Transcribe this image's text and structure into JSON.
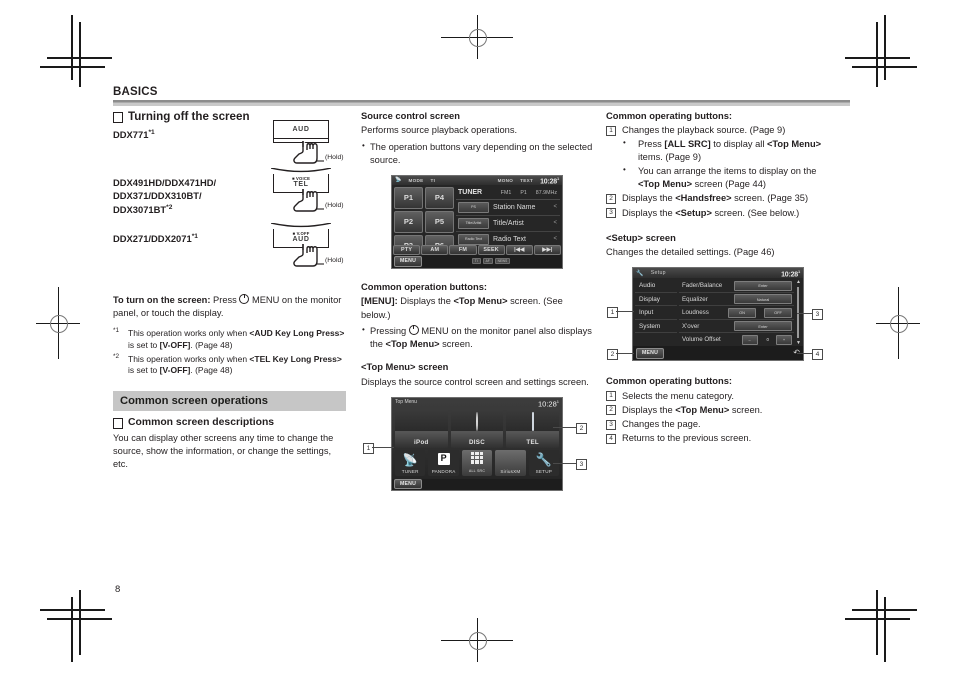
{
  "document": {
    "chapter": "BASICS",
    "page_number": "8"
  },
  "left_column": {
    "heading": "Turning off the screen",
    "models": [
      {
        "name": "DDX771",
        "footnote": "*1"
      },
      {
        "name": "DDX491HD/DDX471HD/\nDDX371/DDX310BT/\nDDX3071BT",
        "footnote": "*2"
      },
      {
        "name": "DDX271/DDX2071",
        "footnote": "*1"
      }
    ],
    "model_1_line": "DDX771",
    "model_2_line_1": "DDX491HD/DDX471HD/",
    "model_2_line_2": "DDX371/DDX310BT/",
    "model_2_line_3": "DDX3071BT",
    "model_3_line": "DDX271/DDX2071",
    "buttons": [
      {
        "key_sub": "",
        "key_label": "AUD",
        "hold": "(Hold)"
      },
      {
        "key_sub": "VOICE",
        "key_label": "TEL",
        "hold": "(Hold)"
      },
      {
        "key_sub": "V.OFF",
        "key_label": "AUD",
        "hold": "(Hold)"
      }
    ],
    "turn_on_label": "To turn on the screen:",
    "turn_on_text_a": " Press ",
    "turn_on_text_b": " MENU on the monitor panel, or touch the display.",
    "footnotes": [
      {
        "mark": "*1",
        "text_a": "This operation works only when ",
        "bold_a": "<AUD Key Long Press>",
        "text_b": " is set to ",
        "bold_b": "[V-OFF]",
        "text_c": ". (Page 48)"
      },
      {
        "mark": "*2",
        "text_a": "This operation works only when ",
        "bold_a": "<TEL Key Long Press>",
        "text_b": " is set to ",
        "bold_b": "[V-OFF]",
        "text_c": ". (Page 48)"
      }
    ],
    "section_bar": "Common screen operations",
    "subheading": "Common screen descriptions",
    "body": "You can display other screens any time to change the source, show the information, or change the settings, etc."
  },
  "middle_column": {
    "heading1": "Source control screen",
    "body1": "Performs source playback operations.",
    "bullet1": "The operation buttons vary depending on the selected source.",
    "heading2": "Common operation buttons:",
    "menu_label": "[MENU]:",
    "menu_text_a": " Displays the ",
    "menu_bold": "<Top Menu>",
    "menu_text_b": " screen. (See below.)",
    "bullet2_a": "Pressing ",
    "bullet2_b": " MENU on the monitor panel also displays the ",
    "bullet2_bold": "<Top Menu>",
    "bullet2_c": " screen.",
    "heading3": "<Top Menu> screen",
    "body3": "Displays the source control screen and settings screen.",
    "source_screen": {
      "status_items": [
        "MODE",
        "TI",
        "MONO",
        "TEXT"
      ],
      "clock": "10:28",
      "clock_sm": "1",
      "presets": [
        "P1",
        "P4",
        "P2",
        "P5",
        "P3",
        "P6"
      ],
      "source_name": "TUNER",
      "band": "FM1",
      "preset_no": "P1",
      "frequency": "87.9MHz",
      "rows": [
        {
          "tag": "PS",
          "text": "Station Name"
        },
        {
          "tag": "Title/Artist",
          "text": "Title/Artist"
        },
        {
          "tag": "Radio Text",
          "text": "Radio Text"
        }
      ],
      "function_buttons": [
        "PTY",
        "AM",
        "FM",
        "SEEK",
        "|◀◀",
        "▶▶|"
      ],
      "menu_button": "MENU",
      "bottom_tags": [
        "TI",
        "AF",
        "NEWS"
      ]
    },
    "top_menu_screen": {
      "title": "Top Menu",
      "clock": "10:28",
      "clock_sm": "1",
      "tiles": [
        {
          "label": "iPod",
          "icon": "ipod-icon"
        },
        {
          "label": "DISC",
          "icon": "disc-icon"
        },
        {
          "label": "TEL",
          "icon": "phone-icon"
        }
      ],
      "small_tiles": [
        {
          "label": "TUNER",
          "icon": "antenna-icon"
        },
        {
          "label": "PANDORA",
          "icon": "pandora-icon"
        },
        {
          "label": "ALL SRC",
          "icon": "grid-icon"
        },
        {
          "label": "SiriusXM",
          "icon": "satellite-icon"
        },
        {
          "label": "SETUP",
          "icon": "wrench-icon"
        }
      ],
      "menu_button": "MENU",
      "callouts": [
        "1",
        "2",
        "3"
      ]
    }
  },
  "right_column": {
    "heading1": "Common operating buttons:",
    "items1": [
      {
        "num": "1",
        "text": "Changes the playback source. (Page 9)",
        "subs": [
          {
            "a": "Press ",
            "bold1": "[ALL SRC]",
            "b": " to display all ",
            "bold2": "<Top Menu>",
            "c": " items. (Page 9)"
          },
          {
            "a": "You can arrange the items to display on the ",
            "bold1": "<Top Menu>",
            "b": " screen (Page 44)",
            "bold2": "",
            "c": ""
          }
        ]
      },
      {
        "num": "2",
        "text_a": "Displays the ",
        "bold": "<Handsfree>",
        "text_b": " screen. (Page 35)",
        "subs": []
      },
      {
        "num": "3",
        "text_a": "Displays the ",
        "bold": "<Setup>",
        "text_b": " screen. (See below.)",
        "subs": []
      }
    ],
    "heading2": "<Setup> screen",
    "body2": "Changes the detailed settings. (Page 46)",
    "setup_screen": {
      "title": "Setup",
      "clock": "10:28",
      "clock_sm": "1",
      "categories": [
        "Audio",
        "Display",
        "Input",
        "System"
      ],
      "rows": [
        {
          "label": "Fader/Balance",
          "values": [
            "Enter"
          ]
        },
        {
          "label": "Equalizer",
          "values": [
            "Natural"
          ]
        },
        {
          "label": "Loudness",
          "values": [
            "ON",
            "OFF"
          ]
        },
        {
          "label": "X'over",
          "values": [
            "Enter"
          ]
        },
        {
          "label": "Volume Offset",
          "values": [
            "–",
            "0",
            "+"
          ]
        }
      ],
      "menu_button": "MENU",
      "callouts": [
        "1",
        "2",
        "3",
        "4"
      ]
    },
    "heading3": "Common operating buttons:",
    "items2": [
      {
        "num": "1",
        "text": "Selects the menu category."
      },
      {
        "num": "2",
        "text_a": "Displays the ",
        "bold": "<Top Menu>",
        "text_b": " screen."
      },
      {
        "num": "3",
        "text": "Changes the page."
      },
      {
        "num": "4",
        "text": "Returns to the previous screen."
      }
    ]
  }
}
